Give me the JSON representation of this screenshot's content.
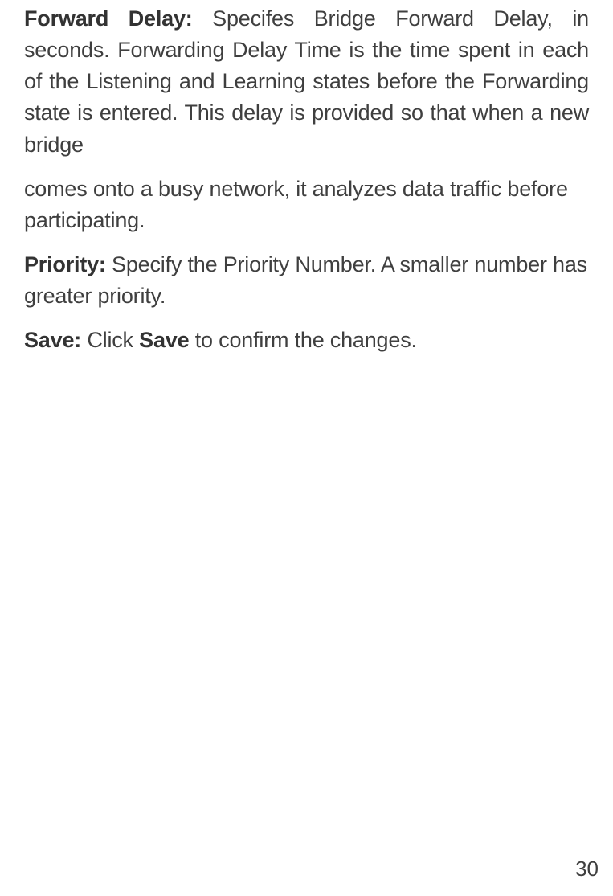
{
  "paragraphs": {
    "forward_delay": {
      "label": "Forward Delay:",
      "text_part1": " Specifes Bridge Forward Delay, in seconds. Forwarding Delay Time is the time spent in each of the Listening and Learning states before the Forwarding state is entered. This delay is provided so that when a new bridge",
      "text_part2": "comes onto a busy network, it analyzes data traffic before participating."
    },
    "priority": {
      "label": "Priority:",
      "text": " Specify the Priority Number. A smaller number has greater priority."
    },
    "save": {
      "label": "Save:",
      "text_before": " Click ",
      "bold_word": "Save",
      "text_after": " to confirm the changes."
    }
  },
  "page_number": "30"
}
